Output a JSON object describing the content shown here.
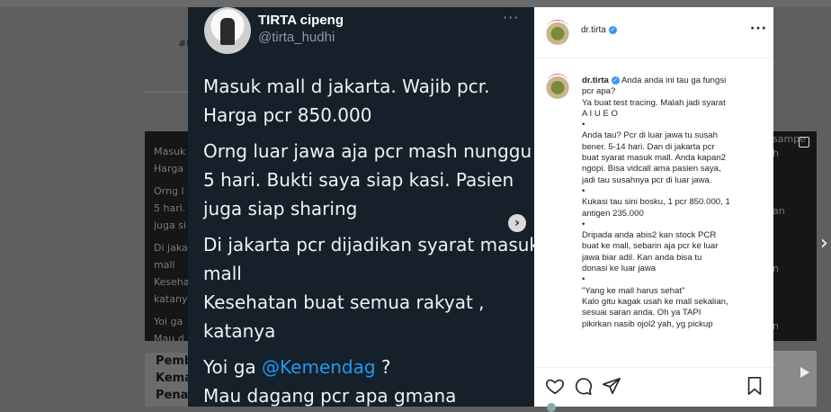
{
  "background": {
    "left_text": "#l",
    "post_left_lines": [
      "Masuk",
      "Harga",
      "Orng l",
      "5 hari.",
      "juga si",
      "Di jaka",
      "mall",
      "Keseha",
      "katany",
      "Yoi ga",
      "Mau d"
    ],
    "post_right_lines": [
      "sampe",
      "h",
      "an",
      "n",
      "n"
    ],
    "headline_lines": [
      "Pemb",
      "Kema",
      "Pena"
    ]
  },
  "tweet": {
    "name": "TIRTA cipeng",
    "handle": "@tirta_hudhi",
    "more": "···",
    "lines": [
      "Masuk mall  d jakarta. Wajib pcr.",
      "Harga pcr 850.000",
      "Orng luar jawa aja pcr mash nunggu",
      "5 hari. Bukti saya siap kasi. Pasien",
      "juga siap sharing",
      "Di jakarta pcr dijadikan syarat masuk",
      "mall",
      "Kesehatan buat semua rakyat ,",
      "katanya",
      "Mau dagang pcr apa gmana"
    ],
    "mention_prefix": "Yoi ga ",
    "mention": "@Kemendag",
    "mention_suffix": " ?"
  },
  "instagram": {
    "username": "dr.tirta",
    "more": "···",
    "caption_first": " Anda anda ini tau ga fungsi",
    "caption_lines": [
      "pcr apa?",
      "Ya buat test tracing. Malah jadi syarat",
      "A I U E O",
      "•",
      "Anda tau? Pcr di luar jawa tu susah",
      "bener. 5-14 hari. Dan di jakarta pcr",
      "buat syarat masuk mall. Anda kapan2",
      "ngopi. Bisa vidcall ama pasien saya,",
      "jadi tau susahnya pcr di luar jawa.",
      "•",
      "Kukasi tau sini bosku, 1 pcr 850.000, 1",
      "antigen 235.000",
      "•",
      "Dripada anda abis2 kan stock PCR",
      "buat ke mall, sebarin aja pcr ke luar",
      "jawa biar adil. Kan anda bisa tu",
      "donasi ke luar jawa",
      "•",
      "\"Yang ke mall harus sehat\"",
      "Kalo gitu kagak usah ke mall sekalian,",
      "sesuai saran anda. Oh ya TAPI",
      "pikirkan nasib ojol2 yah, yg pickup"
    ],
    "verified_mark": "✓"
  },
  "nav": {
    "next": "›",
    "carousel_next": "›"
  }
}
